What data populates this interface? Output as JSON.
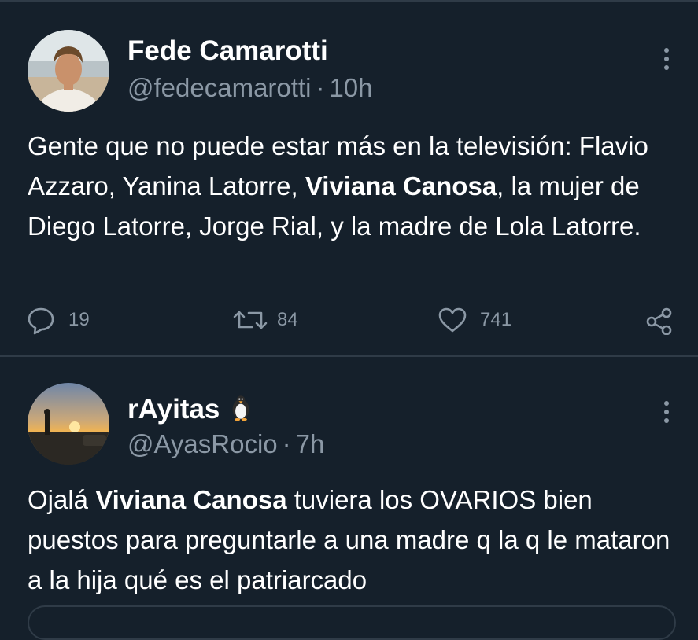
{
  "tweets": [
    {
      "display_name": "Fede Camarotti",
      "handle": "@fedecamarotti",
      "separator": "·",
      "time": "10h",
      "text": [
        {
          "t": "Gente que no puede estar más en la televisión: Flavio Azzaro, Yanina Latorre, ",
          "b": false
        },
        {
          "t": "Viviana Canosa",
          "b": true
        },
        {
          "t": ", la mujer de Diego Latorre, Jorge Rial, y la madre de Lola Latorre.",
          "b": false
        }
      ],
      "actions": {
        "replies": "19",
        "retweets": "84",
        "likes": "741"
      }
    },
    {
      "display_name": "rAyitas",
      "name_emoji": "penguin-icon",
      "handle": "@AyasRocio",
      "separator": "·",
      "time": "7h",
      "text": [
        {
          "t": "Ojalá ",
          "b": false
        },
        {
          "t": "Viviana Canosa",
          "b": true
        },
        {
          "t": " tuviera los OVARIOS bien puestos para preguntarle a una madre q la q le mataron a la hija qué es el patriarcado",
          "b": false
        }
      ]
    }
  ],
  "icons": {
    "reply": "comment-icon",
    "retweet": "retweet-icon",
    "like": "heart-icon",
    "share": "share-icon",
    "more": "more-vertical-icon"
  },
  "colors": {
    "background": "#15202b",
    "text_primary": "#ffffff",
    "text_secondary": "#8b98a5",
    "border": "#2f3b47"
  }
}
